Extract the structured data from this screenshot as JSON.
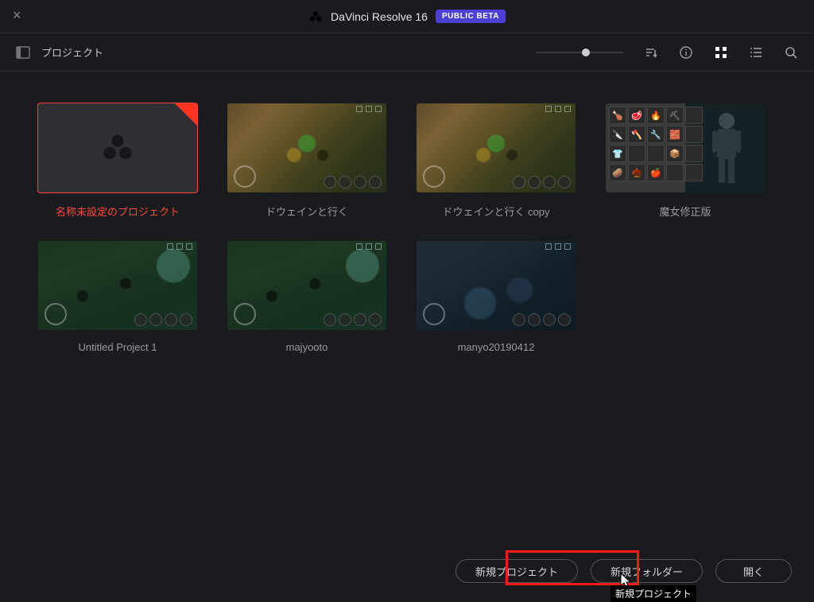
{
  "titlebar": {
    "app_name": "DaVinci Resolve 16",
    "badge": "PUBLIC BETA"
  },
  "toolbar": {
    "section_label": "プロジェクト"
  },
  "projects": [
    {
      "label": "名称未設定のプロジェクト",
      "selected": true,
      "thumb": "placeholder"
    },
    {
      "label": "ドウェインと行く",
      "selected": false,
      "thumb": "game-brown"
    },
    {
      "label": "ドウェインと行く copy",
      "selected": false,
      "thumb": "game-brown"
    },
    {
      "label": "魔女修正版",
      "selected": false,
      "thumb": "game-inv"
    },
    {
      "label": "Untitled Project 1",
      "selected": false,
      "thumb": "game-green"
    },
    {
      "label": "majyooto",
      "selected": false,
      "thumb": "game-green"
    },
    {
      "label": "manyo20190412",
      "selected": false,
      "thumb": "game-dark"
    }
  ],
  "footer": {
    "new_project": "新規プロジェクト",
    "new_folder": "新規フォルダー",
    "open": "開く",
    "tooltip": "新規プロジェクト"
  }
}
